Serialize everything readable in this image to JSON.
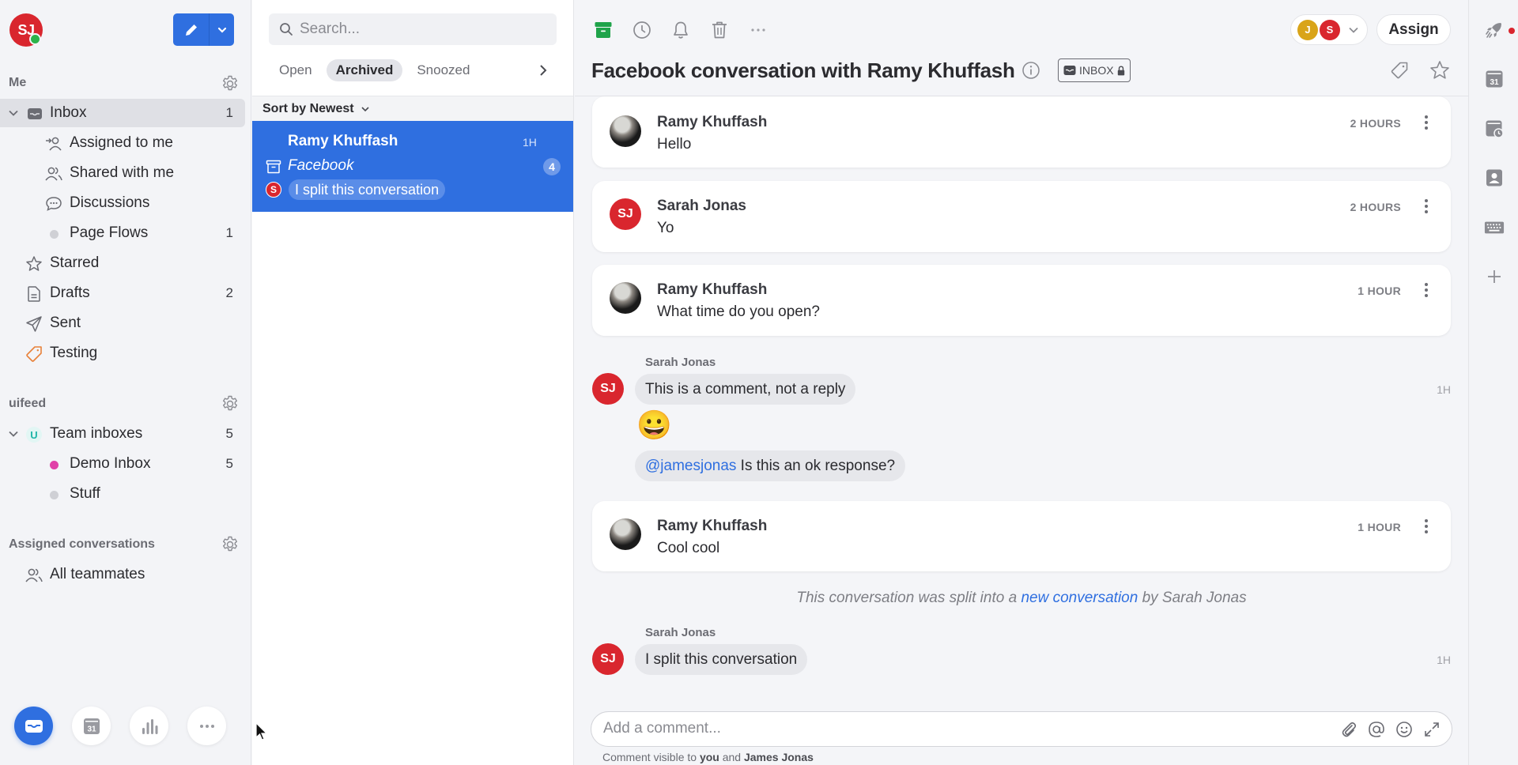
{
  "user": {
    "initials": "SJ",
    "status": "online"
  },
  "colors": {
    "accent": "#2f6fe0",
    "avatar_red": "#d9262e",
    "online_green": "#2cb34a",
    "archive_green": "#1fa34a",
    "demo_inbox_dot": "#e040a8",
    "team_badge": "#1fb5a8",
    "assignee_j": "#d9a419"
  },
  "sidebar": {
    "compose_icon": "pencil-icon",
    "me_section": {
      "title": "Me"
    },
    "me_items": [
      {
        "label": "Inbox",
        "icon": "inbox-icon",
        "count": "1",
        "active": true
      },
      {
        "label": "Assigned to me",
        "icon": "assigned-user-icon",
        "count": ""
      },
      {
        "label": "Shared with me",
        "icon": "shared-users-icon",
        "count": ""
      },
      {
        "label": "Discussions",
        "icon": "chat-bubble-icon",
        "count": ""
      },
      {
        "label": "Page Flows",
        "icon": "dot-icon",
        "count": "1"
      },
      {
        "label": "Starred",
        "icon": "star-icon",
        "count": ""
      },
      {
        "label": "Drafts",
        "icon": "document-icon",
        "count": "2"
      },
      {
        "label": "Sent",
        "icon": "send-icon",
        "count": ""
      },
      {
        "label": "Testing",
        "icon": "tag-icon",
        "count": ""
      }
    ],
    "team_section": {
      "title": "uifeed"
    },
    "team_items": [
      {
        "label": "Team inboxes",
        "badge": "U",
        "count": "5"
      },
      {
        "label": "Demo Inbox",
        "icon": "dot-icon",
        "count": "5"
      },
      {
        "label": "Stuff",
        "icon": "dot-icon",
        "count": ""
      }
    ],
    "assigned_section": {
      "title": "Assigned conversations"
    },
    "assigned_items": [
      {
        "label": "All teammates",
        "icon": "shared-users-icon"
      }
    ],
    "bottom_buttons": [
      {
        "name": "inbox",
        "icon": "inbox-icon",
        "active": true
      },
      {
        "name": "calendar",
        "icon": "calendar-icon",
        "text": "31"
      },
      {
        "name": "analytics",
        "icon": "bar-chart-icon"
      },
      {
        "name": "more",
        "icon": "more-horizontal-icon"
      }
    ]
  },
  "list": {
    "search_placeholder": "Search...",
    "tabs": [
      {
        "label": "Open",
        "active": false
      },
      {
        "label": "Archived",
        "active": true
      },
      {
        "label": "Snoozed",
        "active": false
      }
    ],
    "sort_label": "Sort by Newest",
    "conversations": [
      {
        "name": "Ramy Khuffash",
        "time": "1H",
        "channel": "Facebook",
        "count": "4",
        "preview_author_initial": "S",
        "preview": "I split this conversation",
        "selected": true
      }
    ]
  },
  "conversation": {
    "title": "Facebook conversation with Ramy Khuffash",
    "inbox_chip": "INBOX",
    "assignees": [
      {
        "initial": "J"
      },
      {
        "initial": "S"
      }
    ],
    "assign_label": "Assign",
    "messages": [
      {
        "sender": "Ramy Khuffash",
        "body": "Hello",
        "time": "2 HOURS",
        "avatar": "photo"
      },
      {
        "sender": "Sarah Jonas",
        "body": "Yo",
        "time": "2 HOURS",
        "avatar": "SJ"
      },
      {
        "sender": "Ramy Khuffash",
        "body": "What time do you open?",
        "time": "1 HOUR",
        "avatar": "photo"
      },
      {
        "sender": "Ramy Khuffash",
        "body": "Cool cool",
        "time": "1 HOUR",
        "avatar": "photo"
      }
    ],
    "comment_group_1": {
      "author": "Sarah Jonas",
      "avatar": "SJ",
      "time": "1H",
      "text": "This is a comment, not a reply",
      "emoji": "😀",
      "mention": "@jamesjonas",
      "mention_text": " Is this an ok response?"
    },
    "system_note": {
      "prefix": "This conversation was split into a ",
      "link": "new conversation",
      "suffix": " by Sarah Jonas"
    },
    "comment_group_2": {
      "author": "Sarah Jonas",
      "avatar": "SJ",
      "time": "1H",
      "text": "I split this conversation"
    },
    "composer": {
      "placeholder": "Add a comment...",
      "visibility_prefix": "Comment visible to ",
      "visibility_you": "you",
      "visibility_and": " and ",
      "visibility_person": "James Jonas"
    }
  },
  "rail": {
    "items": [
      {
        "icon": "rocket-icon",
        "notification": true
      },
      {
        "icon": "calendar-icon",
        "text": "31"
      },
      {
        "icon": "calendar-clock-icon"
      },
      {
        "icon": "contact-icon"
      },
      {
        "icon": "keyboard-icon"
      },
      {
        "icon": "plus-icon"
      }
    ]
  }
}
